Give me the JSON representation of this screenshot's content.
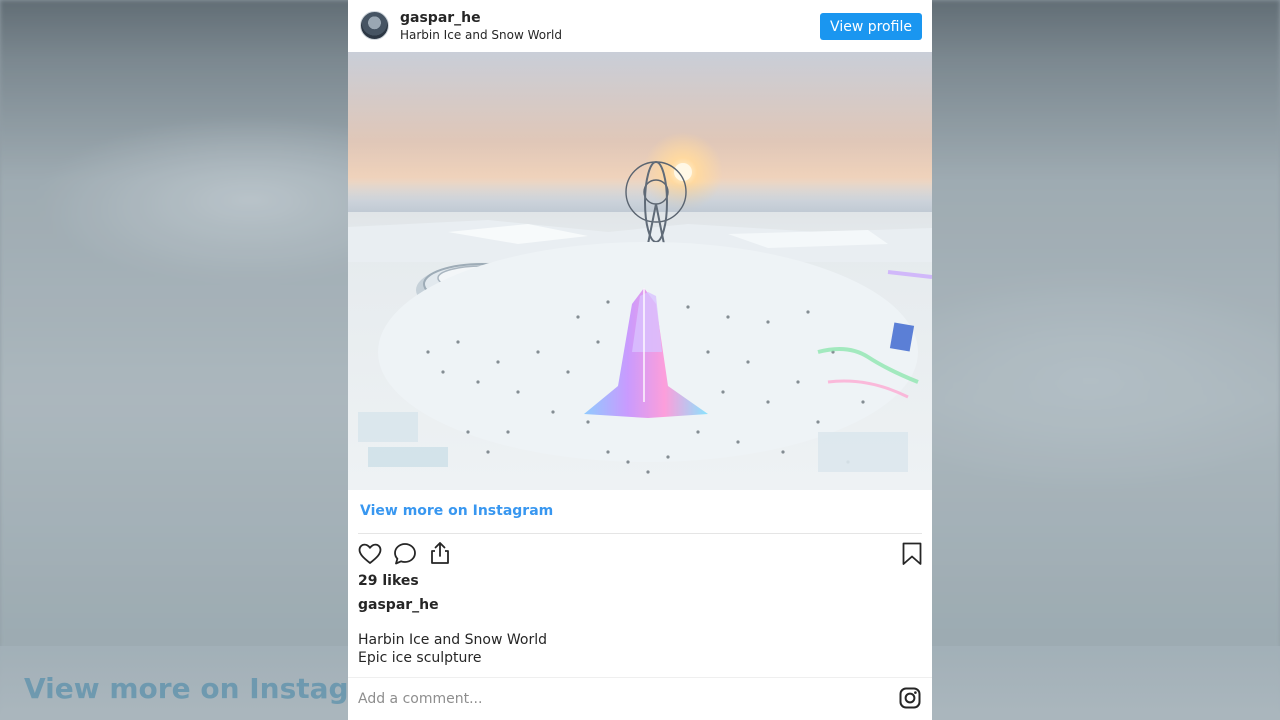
{
  "post": {
    "username": "gaspar_he",
    "location": "Harbin Ice and Snow World",
    "view_profile_label": "View profile",
    "view_more_label": "View more on Instagram",
    "likes_text": "29 likes",
    "caption_user": "gaspar_he",
    "caption_lines": [
      "Harbin Ice and Snow World",
      "Epic ice sculpture"
    ],
    "comment_placeholder": "Add a comment..."
  },
  "background": {
    "overlay_text": "View more on Instagra"
  },
  "icons": {
    "like": "heart-outline-icon",
    "comment": "speech-bubble-icon",
    "share": "share-upload-icon",
    "save": "bookmark-icon",
    "instagram": "instagram-logo-icon"
  },
  "colors": {
    "accent": "#1a96f0",
    "link": "#3897f0",
    "text": "#262626",
    "muted": "#8e8e8e"
  }
}
